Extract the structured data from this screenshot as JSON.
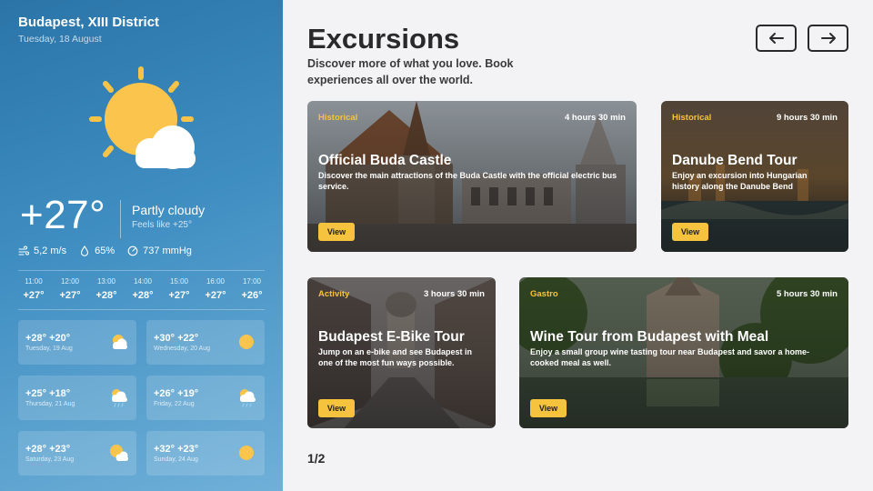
{
  "weather": {
    "location": "Budapest, XIII District",
    "date": "Tuesday, 18 August",
    "current_icon": "partly-cloudy-icon",
    "temperature": "+27°",
    "condition": "Partly cloudy",
    "feels_like": "Feels like +25°",
    "wind": "5,2 m/s",
    "humidity": "65%",
    "pressure": "737 mmHg",
    "hourly": [
      {
        "time": "11:00",
        "temp": "+27°"
      },
      {
        "time": "12:00",
        "temp": "+27°"
      },
      {
        "time": "13:00",
        "temp": "+28°"
      },
      {
        "time": "14:00",
        "temp": "+28°"
      },
      {
        "time": "15:00",
        "temp": "+27°"
      },
      {
        "time": "16:00",
        "temp": "+27°"
      },
      {
        "time": "17:00",
        "temp": "+26°"
      }
    ],
    "daily": [
      {
        "temps": "+28° +20°",
        "date": "Tuesday, 19 Aug",
        "icon": "partly-cloudy-icon"
      },
      {
        "temps": "+30° +22°",
        "date": "Wednesday, 20 Aug",
        "icon": "sun-icon"
      },
      {
        "temps": "+25° +18°",
        "date": "Thursday, 21 Aug",
        "icon": "rain-icon"
      },
      {
        "temps": "+26° +19°",
        "date": "Friday, 22 Aug",
        "icon": "rain-icon"
      },
      {
        "temps": "+28° +23°",
        "date": "Saturday, 23 Aug",
        "icon": "partly-cloudy-icon"
      },
      {
        "temps": "+32° +23°",
        "date": "Sunday, 24 Aug",
        "icon": "sun-icon"
      }
    ]
  },
  "excursions": {
    "title": "Excursions",
    "subtitle": "Discover more of what you love. Book experiences all over the world.",
    "prev_icon": "arrow-left-icon",
    "next_icon": "arrow-right-icon",
    "page": "1/2",
    "accent_color": "#f6c33f",
    "cards": [
      {
        "category": "Historical",
        "duration": "4 hours 30 min",
        "title": "Official Buda Castle",
        "description": "Discover the main attractions of the Buda Castle with the official electric bus service.",
        "button": "View"
      },
      {
        "category": "Historical",
        "duration": "9 hours 30 min",
        "title": "Danube Bend Tour",
        "description": "Enjoy an excursion into Hungarian history along the Danube Bend",
        "button": "View"
      },
      {
        "category": "Activity",
        "duration": "3 hours 30 min",
        "title": "Budapest E-Bike Tour",
        "description": "Jump on an e-bike and see Budapest in one of the most fun ways possible.",
        "button": "View"
      },
      {
        "category": "Gastro",
        "duration": "5 hours 30 min",
        "title": "Wine Tour from Budapest with Meal",
        "description": "Enjoy a small group wine tasting tour near Budapest and savor a home-cooked meal as well.",
        "button": "View"
      }
    ]
  }
}
